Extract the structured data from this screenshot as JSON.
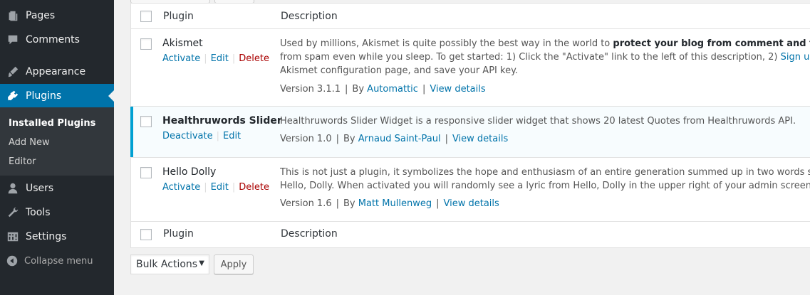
{
  "sidebar": {
    "items": [
      {
        "label": "Pages",
        "icon": "pages-icon"
      },
      {
        "label": "Comments",
        "icon": "comments-icon"
      },
      {
        "label": "Appearance",
        "icon": "appearance-icon"
      },
      {
        "label": "Plugins",
        "icon": "plugins-icon"
      },
      {
        "label": "Users",
        "icon": "users-icon"
      },
      {
        "label": "Tools",
        "icon": "tools-icon"
      },
      {
        "label": "Settings",
        "icon": "settings-icon"
      }
    ],
    "submenu": [
      "Installed Plugins",
      "Add New",
      "Editor"
    ],
    "collapse_label": "Collapse menu"
  },
  "table": {
    "col_plugin": "Plugin",
    "col_description": "Description",
    "plugins": [
      {
        "name": "Akismet",
        "actions": [
          "Activate",
          "Edit",
          "Delete"
        ],
        "desc_line1_pre": "Used by millions, Akismet is quite possibly the best way in the world to ",
        "desc_line1_bold": "protect your blog from comment and trackback sp",
        "desc_line2_pre": "from spam even while you sleep. To get started: 1) Click the \"Activate\" link to the left of this description, 2) ",
        "desc_line2_link": "Sign up for an Ak",
        "desc_line3": "Akismet configuration page, and save your API key.",
        "version": "Version 3.1.1",
        "by": "By",
        "author": "Automattic",
        "details": "View details"
      },
      {
        "name": "Healthruwords Slider",
        "actions": [
          "Deactivate",
          "Edit"
        ],
        "desc_line1": "Healthruwords Slider Widget is a responsive slider widget that shows 20 latest Quotes from Healthruwords API.",
        "version": "Version 1.0",
        "by": "By",
        "author": "Arnaud Saint-Paul",
        "details": "View details"
      },
      {
        "name": "Hello Dolly",
        "actions": [
          "Activate",
          "Edit",
          "Delete"
        ],
        "desc_line1": "This is not just a plugin, it symbolizes the hope and enthusiasm of an entire generation summed up in two words sung mos",
        "desc_line2": "Hello, Dolly. When activated you will randomly see a lyric from Hello, Dolly in the upper right of your admin screen on every",
        "version": "Version 1.6",
        "by": "By",
        "author": "Matt Mullenweg",
        "details": "View details"
      }
    ]
  },
  "bulk": {
    "select_value": "Bulk Actions",
    "apply_label": "Apply"
  },
  "colors": {
    "sidebar_bg": "#23282d",
    "accent": "#0073aa",
    "active_border": "#00a0d2",
    "delete": "#aa0000"
  }
}
